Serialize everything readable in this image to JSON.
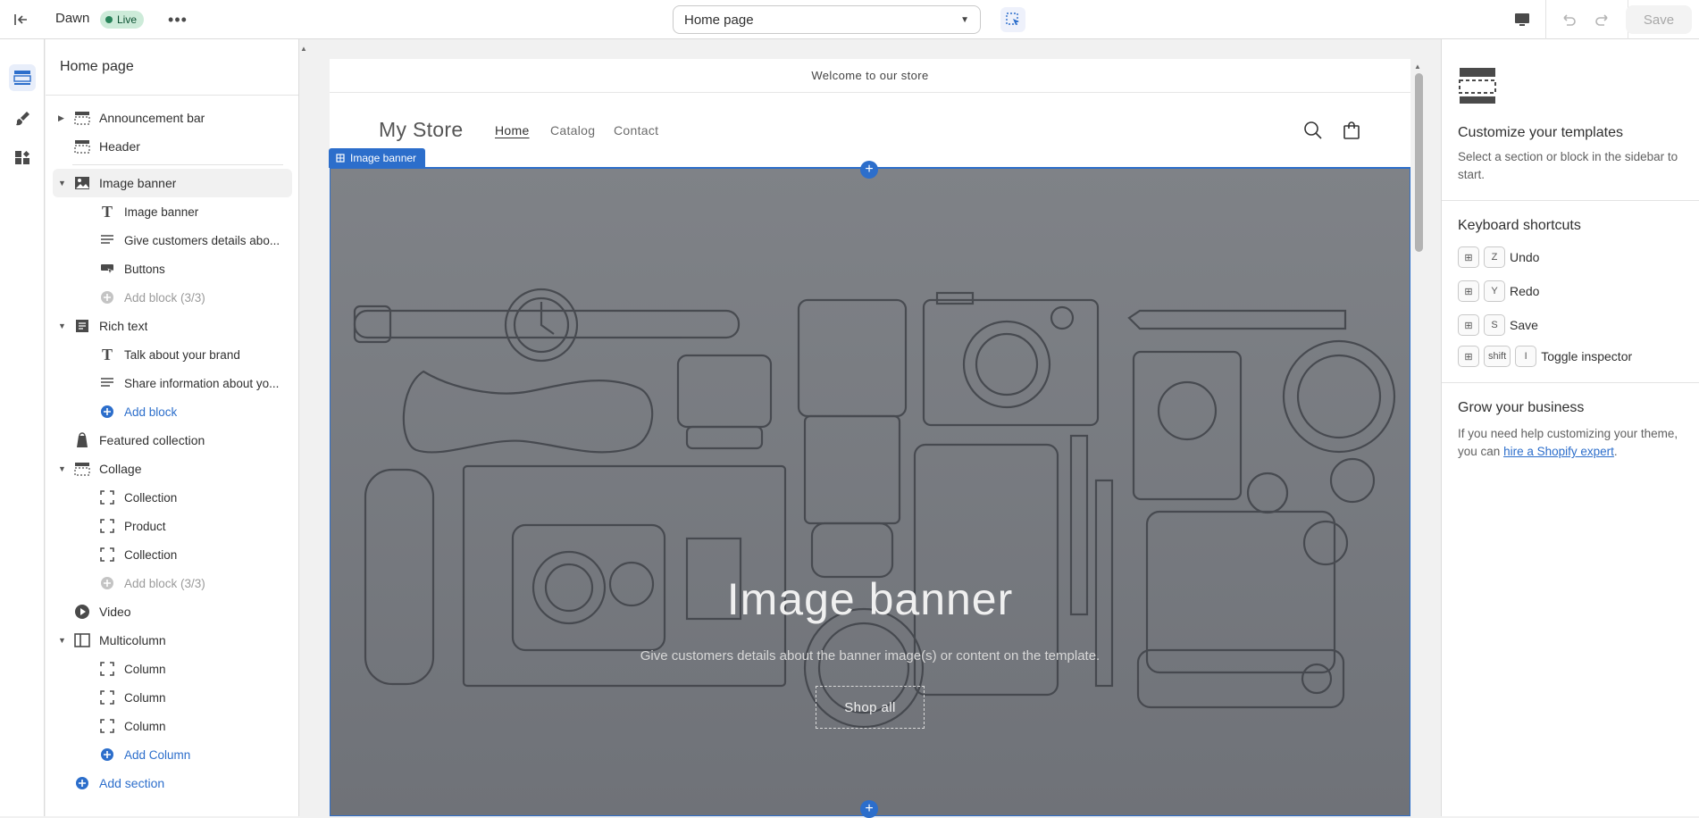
{
  "topbar": {
    "theme_name": "Dawn",
    "status_badge": "Live",
    "more": "•••",
    "page_selector": "Home page",
    "save_label": "Save"
  },
  "sidebar": {
    "title": "Home page",
    "items": [
      {
        "label": "Announcement bar"
      },
      {
        "label": "Header"
      },
      {
        "label": "Image banner"
      },
      {
        "label": "Image banner"
      },
      {
        "label": "Give customers details abo..."
      },
      {
        "label": "Buttons"
      },
      {
        "label": "Add block (3/3)"
      },
      {
        "label": "Rich text"
      },
      {
        "label": "Talk about your brand"
      },
      {
        "label": "Share information about yo..."
      },
      {
        "label": "Add block"
      },
      {
        "label": "Featured collection"
      },
      {
        "label": "Collage"
      },
      {
        "label": "Collection"
      },
      {
        "label": "Product"
      },
      {
        "label": "Collection"
      },
      {
        "label": "Add block (3/3)"
      },
      {
        "label": "Video"
      },
      {
        "label": "Multicolumn"
      },
      {
        "label": "Column"
      },
      {
        "label": "Column"
      },
      {
        "label": "Column"
      },
      {
        "label": "Add Column"
      },
      {
        "label": "Add section"
      }
    ]
  },
  "preview": {
    "announcement": "Welcome to our store",
    "store_name": "My Store",
    "nav": [
      "Home",
      "Catalog",
      "Contact"
    ],
    "section_tag": "Image banner",
    "banner_heading": "Image banner",
    "banner_text": "Give customers details about the banner image(s) or content on the template.",
    "banner_button": "Shop all"
  },
  "right_panel": {
    "customize_title": "Customize your templates",
    "customize_text": "Select a section or block in the sidebar to start.",
    "shortcuts_title": "Keyboard shortcuts",
    "shortcuts": [
      {
        "keys": [
          "Z"
        ],
        "label": "Undo"
      },
      {
        "keys": [
          "Y"
        ],
        "label": "Redo"
      },
      {
        "keys": [
          "S"
        ],
        "label": "Save"
      },
      {
        "keys": [
          "shift",
          "I"
        ],
        "label": "Toggle inspector"
      }
    ],
    "grow_title": "Grow your business",
    "grow_text": "If you need help customizing your theme, you can",
    "grow_link": "hire a Shopify expert",
    "grow_end": "."
  },
  "colors": {
    "accent": "#2c6ecb",
    "live_badge": "#cdebd9",
    "banner_overlay": "#7f8287"
  }
}
